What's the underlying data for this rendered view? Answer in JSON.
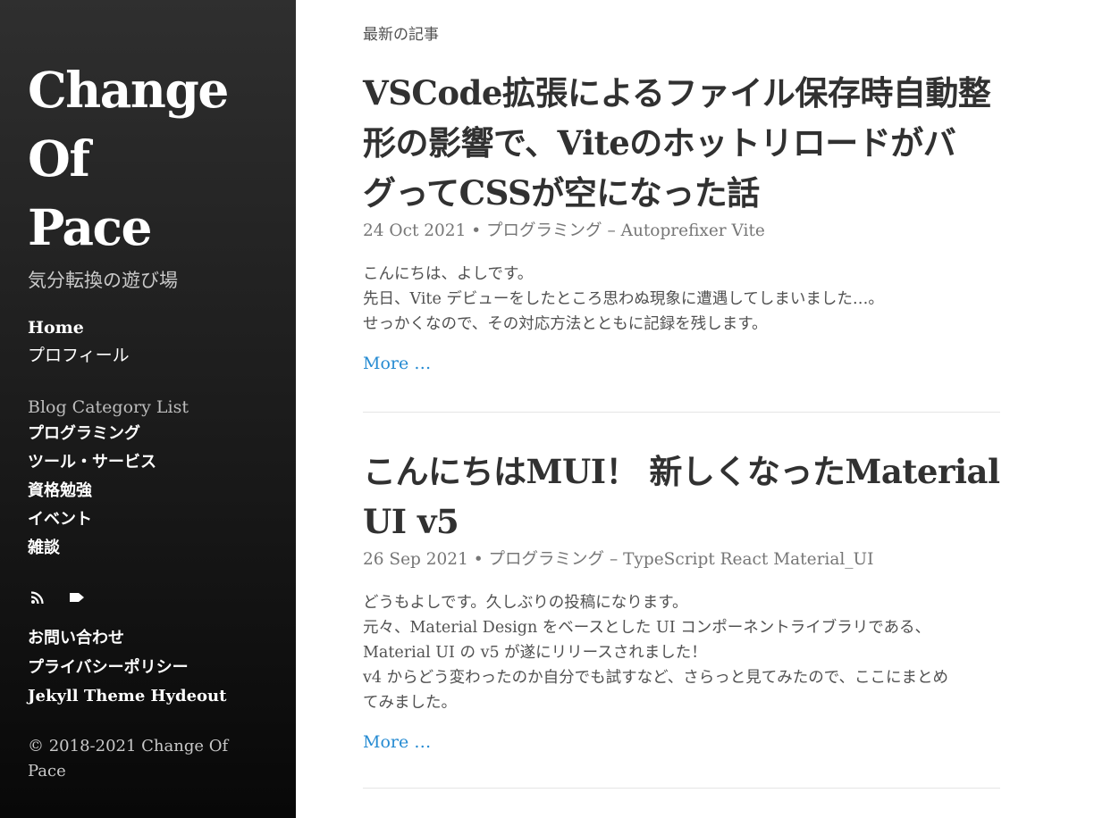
{
  "sidebar": {
    "title_lines": [
      "Change",
      "Of",
      "Pace"
    ],
    "tagline": "気分転換の遊び場",
    "nav": [
      {
        "label": "Home",
        "active": true
      },
      {
        "label": "プロフィール",
        "active": false
      }
    ],
    "category_heading": "Blog Category List",
    "categories": [
      "プログラミング",
      "ツール・サービス",
      "資格勉強",
      "イベント",
      "雑談"
    ],
    "icons": [
      "rss-icon",
      "tag-icon"
    ],
    "footer_links": [
      "お問い合わせ",
      "プライバシーポリシー",
      "Jekyll Theme Hydeout"
    ],
    "copyright": "© 2018-2021 Change Of Pace"
  },
  "main": {
    "section_label": "最新の記事",
    "posts": [
      {
        "title": "VSCode拡張によるファイル保存時自動整形の影響で、Viteのホットリロードがバグってて CSSが空になった話",
        "title_lines": [
          "VSCode拡張によるファイル保存時自動整",
          "形の影響で、Viteのホットリロードがバ",
          "グってCSSが空になった話"
        ],
        "date": "24 Oct 2021",
        "category": "プログラミング",
        "tags": "Autoprefixer Vite",
        "excerpt": [
          "こんにちは、よしです。",
          "先日、Vite デビューをしたところ思わぬ現象に遭遇してしまいました…。",
          "せっかくなので、その対応方法とともに記録を残します。"
        ],
        "more": "More …"
      },
      {
        "title": "こんにちはMUI！ 新しくなったMaterial UI v5",
        "title_lines": [
          "こんにちはMUI！ 新しくなったMaterial",
          "UI v5"
        ],
        "date": "26 Sep 2021",
        "category": "プログラミング",
        "tags": "TypeScript React Material_UI",
        "excerpt": [
          "どうもよしです。久しぶりの投稿になります。",
          "元々、Material Design をベースとした UI コンポーネントライブラリである、",
          "Material UI の v5 が遂にリリースされました！",
          "v4 からどう変わったのか自分でも試すなど、さらっと見てみたので、ここにまとめ",
          "てみました。"
        ],
        "more": "More …"
      }
    ]
  },
  "colors": {
    "sidebar_top": "#2f2f2f",
    "sidebar_bottom": "#080808",
    "link": "#268bd2",
    "title": "#313131",
    "meta": "#767676"
  }
}
